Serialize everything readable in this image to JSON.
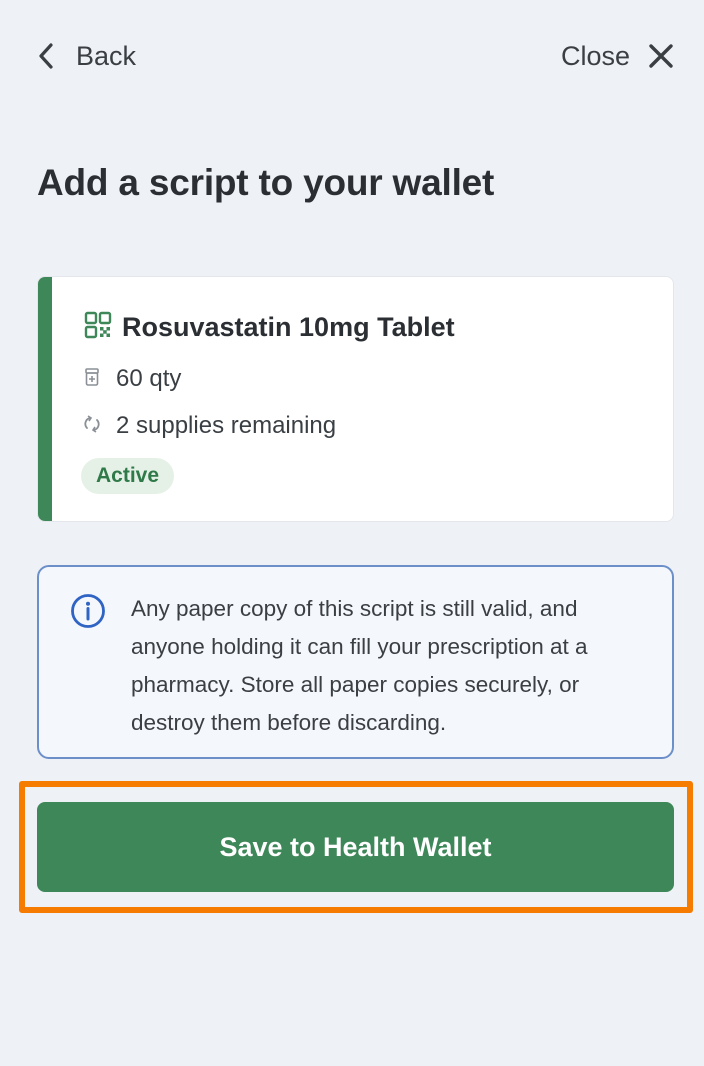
{
  "header": {
    "back_label": "Back",
    "close_label": "Close"
  },
  "page": {
    "title": "Add a script to your wallet"
  },
  "script_card": {
    "medication": "Rosuvastatin 10mg Tablet",
    "quantity": "60 qty",
    "supplies": "2 supplies remaining",
    "status": "Active",
    "accent_color": "#3e8758",
    "icons": [
      "qr-code-icon",
      "pill-box-icon",
      "refresh-icon"
    ]
  },
  "notice": {
    "icon": "info-icon",
    "text": "Any paper copy of this script is still valid, and anyone holding it can fill your prescription at a pharmacy. Store all paper copies securely, or destroy them before discarding."
  },
  "actions": {
    "save_label": "Save to Health Wallet",
    "save_color": "#3e8758",
    "highlight_color": "#f57c00"
  }
}
